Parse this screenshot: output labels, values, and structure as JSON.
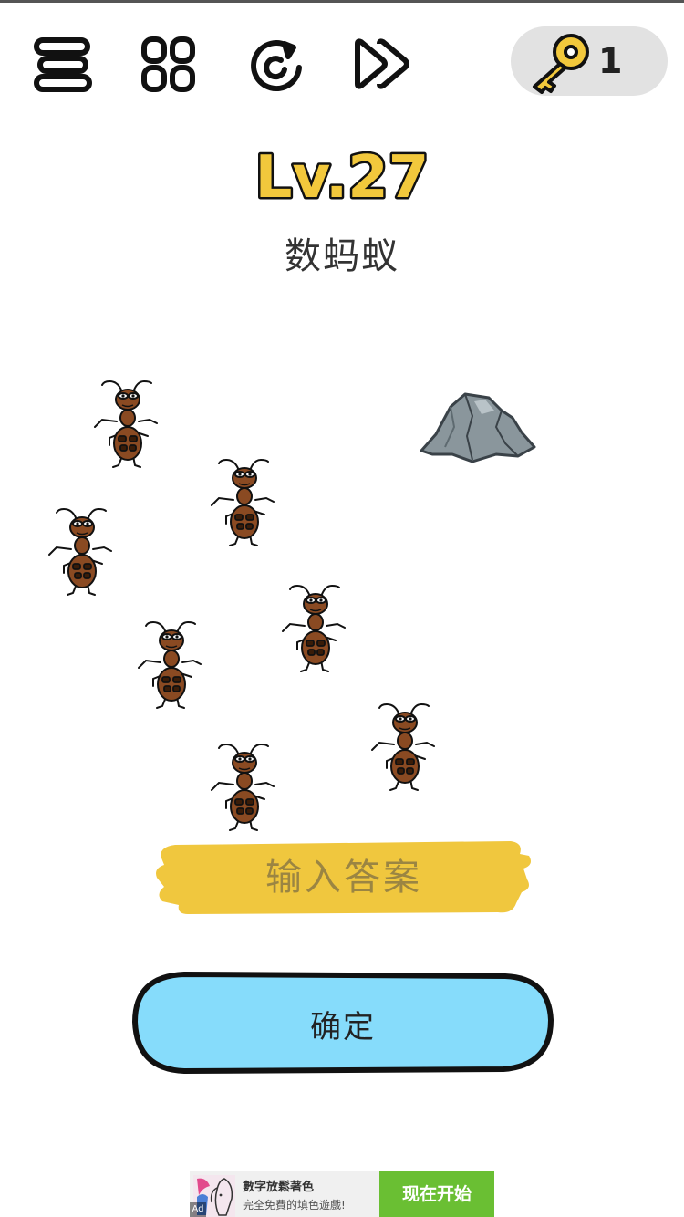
{
  "toolbar": {
    "menu_icon": "menu-icon",
    "levels_icon": "grid-icon",
    "restart_icon": "restart-icon",
    "skip_icon": "fast-forward-icon"
  },
  "hints": {
    "icon": "key-icon",
    "count": "1"
  },
  "level": {
    "title": "Lv.27",
    "question": "数蚂蚁"
  },
  "scene": {
    "ant_icon": "ant-icon",
    "rock_icon": "rock-icon"
  },
  "answer": {
    "placeholder": "输入答案",
    "value": ""
  },
  "confirm": {
    "label": "确定"
  },
  "ad": {
    "tag": "Ad",
    "title": "數字放鬆著色",
    "subtitle": "完全免費的填色遊戲!",
    "cta": "现在开始"
  },
  "colors": {
    "title_yellow": "#f2c83c",
    "plaque_yellow": "#f0c73e",
    "confirm_blue": "#86dcfb",
    "hint_pill": "#e2e2e2",
    "ad_cta_green": "#6abf33",
    "ant_brown": "#8a4a22"
  }
}
